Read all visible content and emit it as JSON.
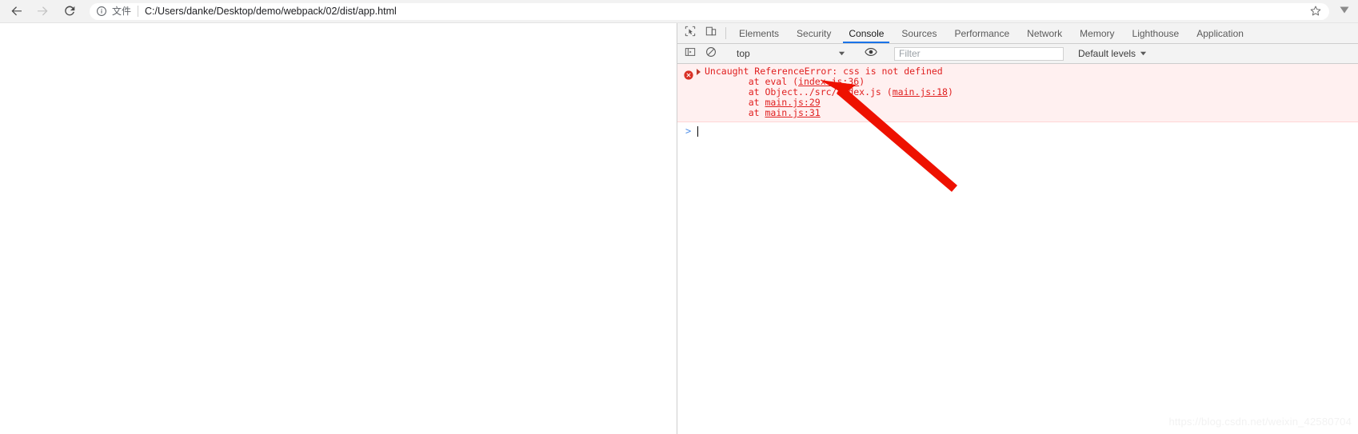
{
  "browser": {
    "nav": {
      "back_label": "Back",
      "forward_label": "Forward",
      "reload_label": "Reload"
    },
    "omnibox": {
      "security_icon": "info-circle-icon",
      "scheme_label": "文件",
      "url": "C:/Users/danke/Desktop/demo/webpack/02/dist/app.html",
      "bookmark_icon": "star-icon"
    },
    "menu_icon": "chevron-down-icon"
  },
  "devtools": {
    "left_icons": [
      {
        "name": "inspect-element-icon",
        "label": "Inspect element"
      },
      {
        "name": "device-toolbar-icon",
        "label": "Toggle device toolbar"
      }
    ],
    "tabs": [
      {
        "label": "Elements",
        "active": false
      },
      {
        "label": "Security",
        "active": false
      },
      {
        "label": "Console",
        "active": true
      },
      {
        "label": "Sources",
        "active": false
      },
      {
        "label": "Performance",
        "active": false
      },
      {
        "label": "Network",
        "active": false
      },
      {
        "label": "Memory",
        "active": false
      },
      {
        "label": "Lighthouse",
        "active": false
      },
      {
        "label": "Application",
        "active": false
      }
    ],
    "filterbar": {
      "sidebar_icon": "console-sidebar-icon",
      "clear_icon": "clear-console-icon",
      "context_value": "top",
      "context_caret": "caret-down-icon",
      "eye_icon": "live-expression-icon",
      "filter_placeholder": "Filter",
      "filter_value": "",
      "levels_label": "Default levels",
      "levels_caret": "caret-down-icon"
    },
    "console": {
      "error": {
        "icon": "error-circle-icon",
        "disclosure": "triangle-right-icon",
        "headline": "Uncaught ReferenceError: css is not defined",
        "frames": [
          {
            "prefix": "    at eval (",
            "link": "index.js:36",
            "suffix": ")"
          },
          {
            "prefix": "    at Object../src/index.js (",
            "link": "main.js:18",
            "suffix": ")"
          },
          {
            "prefix": "    at ",
            "link": "main.js:29",
            "suffix": ""
          },
          {
            "prefix": "    at ",
            "link": "main.js:31",
            "suffix": ""
          }
        ]
      },
      "prompt_caret": ">",
      "prompt_value": ""
    }
  },
  "annotation": {
    "arrow_color": "#ee1100",
    "description": "red arrow pointing to index.js:36 link"
  },
  "watermark": {
    "text": "https://blog.csdn.net/weixin_42580704",
    "color": "#f2f2f2"
  }
}
